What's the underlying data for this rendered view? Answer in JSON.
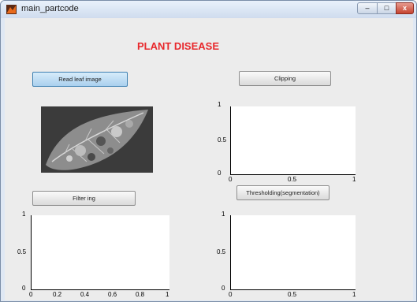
{
  "window": {
    "title": "main_partcode",
    "close_glyph": "x"
  },
  "page": {
    "heading": "PLANT DISEASE",
    "heading_color": "#e8282c"
  },
  "buttons": {
    "read_leaf": "Read leaf image",
    "clipping": "Clipping",
    "filtering": "Filter ing",
    "thresholding": "Thresholding(segmentation)"
  },
  "axes": {
    "clip": {
      "y_ticks": [
        "1",
        "0.5",
        "0"
      ],
      "x_ticks": [
        "0",
        "0.5",
        "1"
      ]
    },
    "filter": {
      "y_ticks": [
        "1",
        "0.5",
        "0"
      ],
      "x_ticks": [
        "0",
        "0.2",
        "0.4",
        "0.6",
        "0.8",
        "1"
      ]
    },
    "threshold": {
      "y_ticks": [
        "1",
        "0.5",
        "0"
      ],
      "x_ticks": [
        "0",
        "0.5",
        "1"
      ]
    }
  },
  "icons": {
    "app": "matlab-icon",
    "leaf": "leaf-image"
  }
}
